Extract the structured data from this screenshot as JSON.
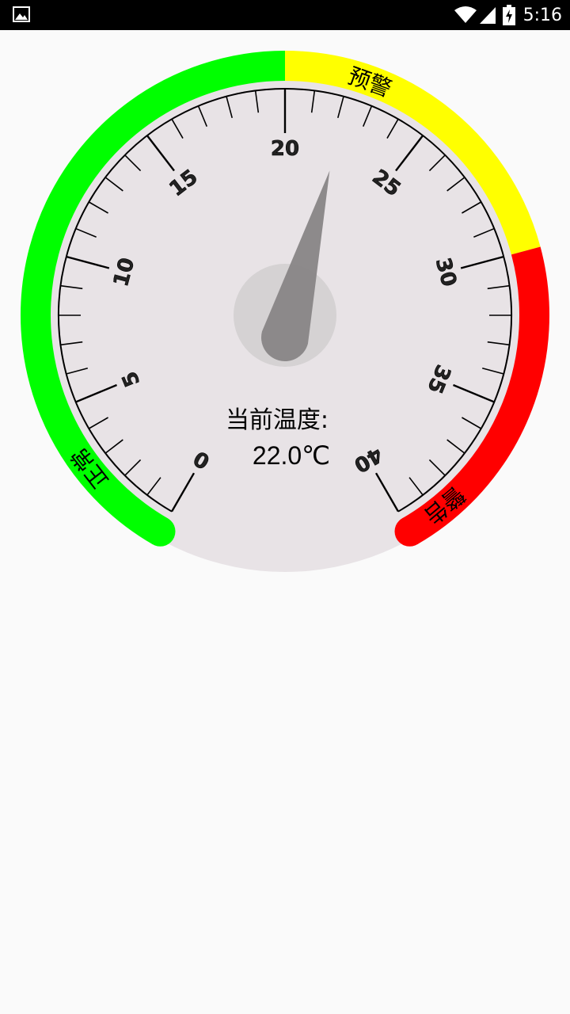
{
  "status_bar": {
    "time": "5:16",
    "icons": {
      "notification": "image-icon",
      "wifi": "wifi-icon",
      "signal": "signal-icon",
      "battery": "battery-charging-icon"
    }
  },
  "gauge": {
    "min": 0,
    "max": 40,
    "value": 22.0,
    "tick_labels": [
      "0",
      "5",
      "10",
      "15",
      "20",
      "25",
      "30",
      "35",
      "40"
    ],
    "zones": [
      {
        "label": "正常",
        "from": 0,
        "to": 20,
        "color": "#00ff00"
      },
      {
        "label": "预警",
        "from": 20,
        "to": 30,
        "color": "#ffff00"
      },
      {
        "label": "警告",
        "from": 30,
        "to": 40,
        "color": "#ff0000"
      }
    ],
    "readout_label": "当前温度:",
    "readout_value": "22.0℃",
    "colors": {
      "dial_face": "#e8e3e6",
      "needle": "#888586",
      "hub": "#d0cdce",
      "tick": "#000000"
    }
  }
}
